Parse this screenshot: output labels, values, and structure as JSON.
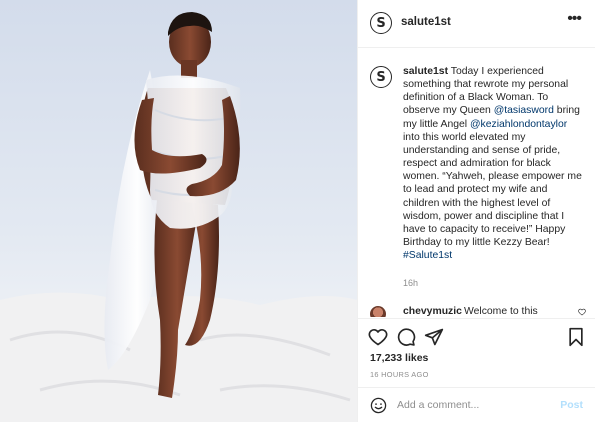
{
  "post": {
    "username": "salute1st",
    "avatar_letter": "S",
    "caption": {
      "username": "salute1st",
      "part1": " Today I experienced something that rewrote my personal definition of a Black Woman. To observe my Queen ",
      "mention1": "@tasiasword",
      "part2": " bring my little Angel ",
      "mention2": "@keziahlondontaylor",
      "part3": " into this world elevated my understanding and sense of pride, respect and admiration for black women. “Yahweh, please empower me to lead and protect my wife and children with the highest level of wisdom, power and discipline that I have to capacity to receive!” Happy Birthday to my little Kezzy Bear! ",
      "hashtag": "#Salute1st"
    },
    "caption_time": "16h",
    "first_comment": {
      "username": "chevymuzic",
      "text": "Welcome to this"
    },
    "likes": "17,233 likes",
    "posted_ago": "16 HOURS AGO",
    "add_comment": {
      "placeholder": "Add a comment...",
      "post_label": "Post"
    }
  },
  "icons": {
    "more": "more-options-icon",
    "like": "heart-icon",
    "comment": "comment-icon",
    "share": "share-icon",
    "save": "bookmark-icon",
    "emoji": "emoji-icon"
  },
  "colors": {
    "text": "#262626",
    "secondary": "#8e8e8e",
    "mention": "#00376b",
    "post_button_disabled": "#b2dffc",
    "divider": "#efefef"
  }
}
